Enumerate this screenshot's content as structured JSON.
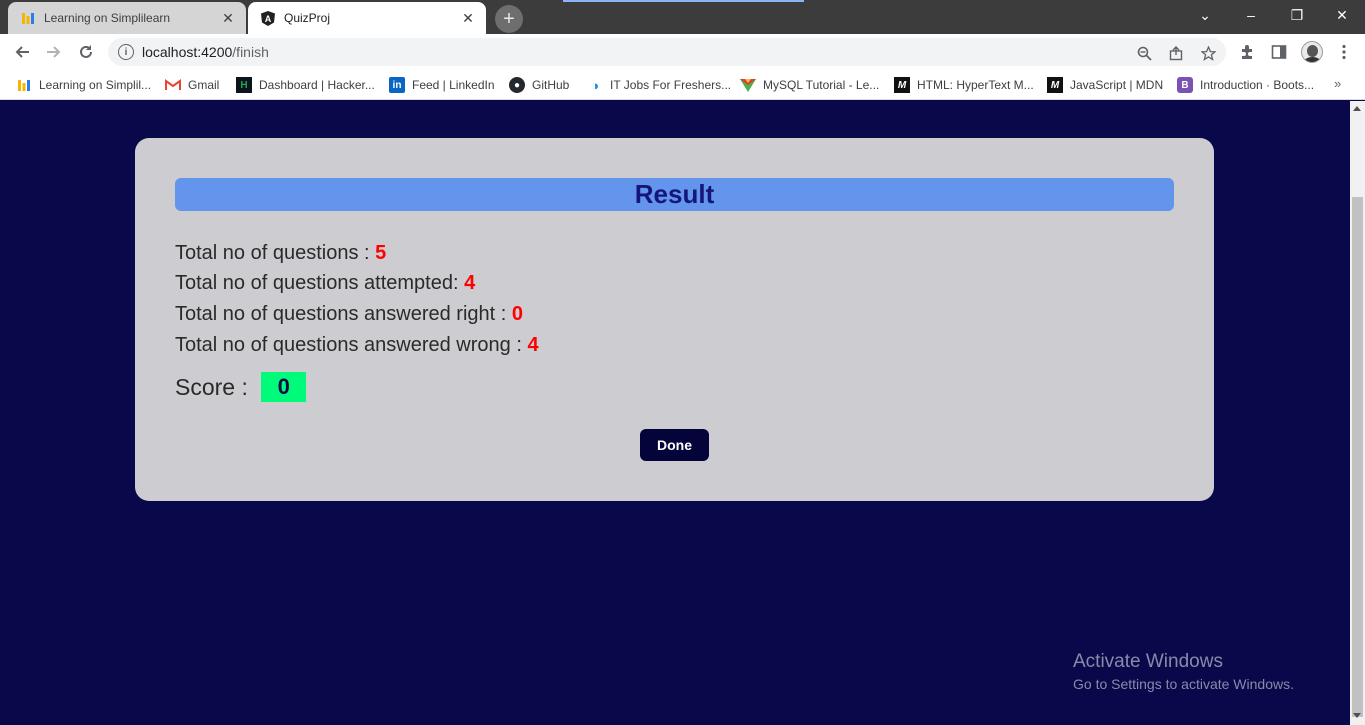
{
  "browser": {
    "tabs": [
      {
        "title": "Learning on Simplilearn",
        "active": false,
        "icon": "simplilearn-icon"
      },
      {
        "title": "QuizProj",
        "active": true,
        "icon": "angular-icon"
      }
    ],
    "new_tab_label": "+",
    "close_glyph": "✕",
    "window_controls": {
      "dropdown": "⌄",
      "minimize": "–",
      "restore": "❐",
      "close": "✕"
    },
    "address": {
      "host": "localhost:4200",
      "path": "/finish"
    },
    "bookmarks": [
      {
        "label": "Learning on Simplil...",
        "icon": "simplilearn-icon"
      },
      {
        "label": "Gmail",
        "icon": "gmail-icon"
      },
      {
        "label": "Dashboard | Hacker...",
        "icon": "hackerrank-icon"
      },
      {
        "label": "Feed | LinkedIn",
        "icon": "linkedin-icon"
      },
      {
        "label": "GitHub",
        "icon": "github-icon"
      },
      {
        "label": "IT Jobs For Freshers...",
        "icon": "jobs-icon"
      },
      {
        "label": "MySQL Tutorial - Le...",
        "icon": "mysql-icon"
      },
      {
        "label": "HTML: HyperText M...",
        "icon": "mdn-icon"
      },
      {
        "label": "JavaScript | MDN",
        "icon": "mdn-icon"
      },
      {
        "label": "Introduction · Boots...",
        "icon": "bootstrap-icon"
      }
    ],
    "bookmarks_more": "»"
  },
  "result": {
    "title": "Result",
    "stats": [
      {
        "label": "Total no of questions : ",
        "value": "5"
      },
      {
        "label": "Total no of questions attempted: ",
        "value": "4"
      },
      {
        "label": "Total no of questions answered right : ",
        "value": "0"
      },
      {
        "label": "Total no of questions answered wrong : ",
        "value": "4"
      }
    ],
    "score_label": "Score : ",
    "score_value": "0",
    "done_label": "Done"
  },
  "watermark": {
    "line1": "Activate Windows",
    "line2": "Go to Settings to activate Windows."
  },
  "colors": {
    "page_bg": "#08084a",
    "card_bg": "#cdcdd1",
    "result_bar": "#6495ed",
    "value_red": "#ff0000",
    "score_green": "#00fa7a",
    "done_button": "#04043a"
  }
}
